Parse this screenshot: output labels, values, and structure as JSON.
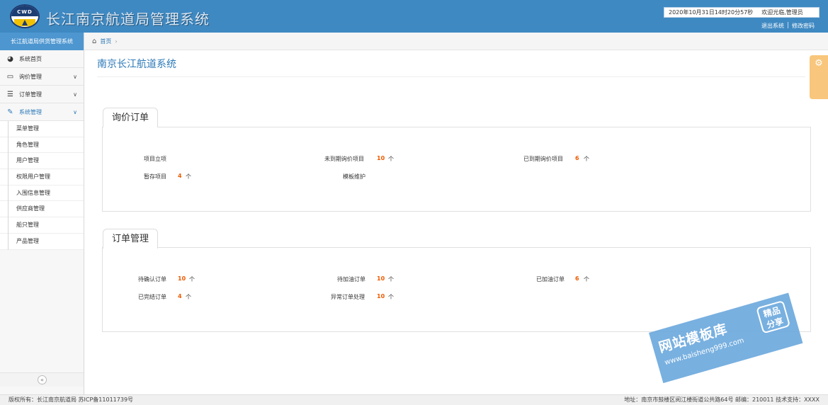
{
  "header": {
    "logo_text": "CWD",
    "system_title": "长江南京航道局管理系统",
    "datetime": "2020年10月31日14时20分57秒",
    "welcome": "欢迎光临,管理员",
    "logout": "退出系统",
    "change_password": "修改密码"
  },
  "sidebar": {
    "title": "长江航道局供货管理系统",
    "menu": [
      {
        "label": "系统首页",
        "icon": "dashboard-icon"
      },
      {
        "label": "询价管理",
        "icon": "monitor-icon"
      },
      {
        "label": "订单管理",
        "icon": "list-icon"
      },
      {
        "label": "系统管理",
        "icon": "edit-icon"
      }
    ],
    "submenu": [
      "菜单管理",
      "角色管理",
      "用户管理",
      "权限用户管理",
      "入围信息管理",
      "供应商管理",
      "船只管理",
      "产品管理"
    ],
    "collapse": "«"
  },
  "breadcrumb": {
    "home": "首页",
    "separator": "›"
  },
  "page": {
    "title": "南京长江航道系统"
  },
  "inquiry": {
    "tab": "询价订单",
    "unit": "个",
    "project_setup": "项目立项",
    "not_due_label": "未到期询价项目",
    "not_due_count": "10",
    "due_label": "已到期询价项目",
    "due_count": "6",
    "draft_label": "暂存项目",
    "draft_count": "4",
    "template_label": "模板维护"
  },
  "orders": {
    "tab": "订单管理",
    "unit": "个",
    "pending_confirm_label": "待确认订单",
    "pending_confirm_count": "10",
    "pending_refuel_label": "待加油订单",
    "pending_refuel_count": "10",
    "refueled_label": "已加油订单",
    "refueled_count": "6",
    "completed_label": "已完结订单",
    "completed_count": "4",
    "exception_label": "异常订单处理",
    "exception_count": "10"
  },
  "watermark": {
    "main": "网站模板库",
    "url": "www.baisheng999.com",
    "badge_line1": "精品",
    "badge_line2": "分享"
  },
  "footer": {
    "left": "版权所有：长江南京航道局 苏ICP备11011739号",
    "right": "地址：南京市鼓楼区阅江楼街道公共路64号 邮编：210011 技术支持：XXXX"
  },
  "colors": {
    "header": "#3f89c2",
    "accent": "#2d79b8",
    "count": "#ee5a00",
    "settings_tab": "#f8c67c"
  }
}
